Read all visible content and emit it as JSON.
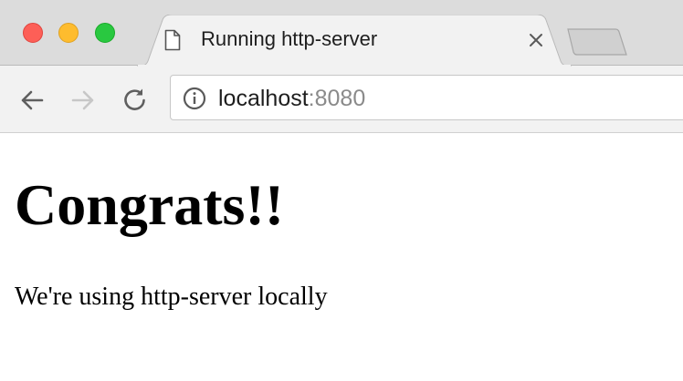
{
  "browser": {
    "tab": {
      "title": "Running http-server",
      "icon": "document-icon",
      "close_icon": "close-icon"
    },
    "window_controls": [
      "close",
      "minimize",
      "maximize"
    ],
    "toolbar": {
      "back_icon": "back-arrow-icon",
      "forward_icon": "forward-arrow-icon",
      "reload_icon": "reload-icon"
    },
    "address_bar": {
      "security_icon": "info-icon",
      "host": "localhost",
      "port": ":8080"
    }
  },
  "page": {
    "heading": "Congrats!!",
    "body_text": "We're using http-server locally"
  },
  "colors": {
    "tab_strip": "#dcdcdc",
    "toolbar": "#f2f2f2",
    "close_light": "#fd5f57",
    "minimize_light": "#febc2e",
    "maximize_light": "#29c840",
    "url_port": "#8a8a8a"
  }
}
